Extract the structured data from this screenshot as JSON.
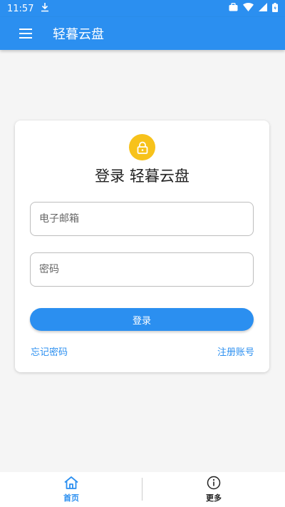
{
  "status_bar": {
    "time": "11:57"
  },
  "app_bar": {
    "title": "轻暮云盘"
  },
  "login_card": {
    "title": "登录 轻暮云盘",
    "email_placeholder": "电子邮箱",
    "password_placeholder": "密码",
    "login_label": "登录",
    "forgot_label": "忘记密码",
    "register_label": "注册账号"
  },
  "bottom_nav": {
    "items": [
      {
        "label": "首页",
        "icon": "home-icon",
        "active": true
      },
      {
        "label": "更多",
        "icon": "info-icon",
        "active": false
      }
    ]
  },
  "colors": {
    "primary": "#2b8ff0",
    "lock": "#f7c21b"
  }
}
